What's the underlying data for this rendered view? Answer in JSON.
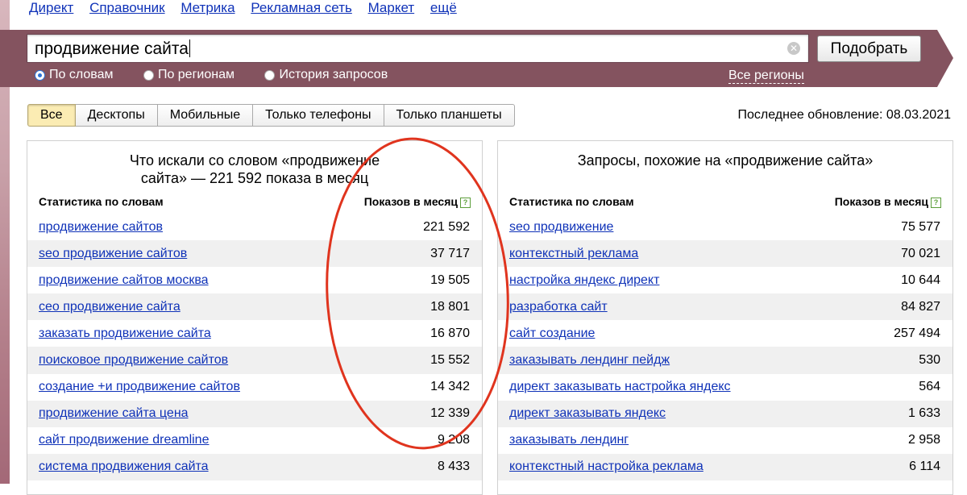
{
  "nav": [
    "Директ",
    "Справочник",
    "Метрика",
    "Рекламная сеть",
    "Маркет",
    "ещё"
  ],
  "search": {
    "query": "продвижение сайта",
    "button": "Подобрать",
    "options": [
      "По словам",
      "По регионам",
      "История запросов"
    ],
    "selected_option": "По словам",
    "regions_link": "Все регионы"
  },
  "tabs": [
    "Все",
    "Десктопы",
    "Мобильные",
    "Только телефоны",
    "Только планшеты"
  ],
  "active_tab": "Все",
  "last_update": "Последнее обновление: 08.03.2021",
  "left_panel": {
    "title_line1": "Что искали со словом «продвижение",
    "title_line2": "сайта» — 221 592 показа в месяц",
    "col_words": "Статистика по словам",
    "col_count": "Показов в месяц",
    "rows": [
      {
        "q": "продвижение сайтов",
        "n": "221 592"
      },
      {
        "q": "seo продвижение сайтов",
        "n": "37 717"
      },
      {
        "q": "продвижение сайтов москва",
        "n": "19 505"
      },
      {
        "q": "сео продвижение сайта",
        "n": "18 801"
      },
      {
        "q": "заказать продвижение сайта",
        "n": "16 870"
      },
      {
        "q": "поисковое продвижение сайтов",
        "n": "15 552"
      },
      {
        "q": "создание +и продвижение сайтов",
        "n": "14 342"
      },
      {
        "q": "продвижение сайта цена",
        "n": "12 339"
      },
      {
        "q": "сайт продвижение dreamline",
        "n": "9 208"
      },
      {
        "q": "система продвижения сайта",
        "n": "8 433"
      }
    ]
  },
  "right_panel": {
    "title": "Запросы, похожие на «продвижение сайта»",
    "col_words": "Статистика по словам",
    "col_count": "Показов в месяц",
    "rows": [
      {
        "q": "seo продвижение",
        "n": "75 577"
      },
      {
        "q": "контекстный реклама",
        "n": "70 021"
      },
      {
        "q": "настройка яндекс директ",
        "n": "10 644"
      },
      {
        "q": "разработка сайт",
        "n": "84 827"
      },
      {
        "q": "сайт создание",
        "n": "257 494"
      },
      {
        "q": "заказывать лендинг пейдж",
        "n": "530"
      },
      {
        "q": "директ заказывать настройка яндекс",
        "n": "564"
      },
      {
        "q": "директ заказывать яндекс",
        "n": "1 633"
      },
      {
        "q": "заказывать лендинг",
        "n": "2 958"
      },
      {
        "q": "контекстный настройка реклама",
        "n": "6 114"
      }
    ]
  },
  "colors": {
    "band": "#84535f",
    "link": "#0f32b8",
    "annotation": "#e0341e",
    "active_tab": "#fbecb3"
  },
  "icons": {
    "clear": "clear-x-icon",
    "help": "help-icon"
  }
}
